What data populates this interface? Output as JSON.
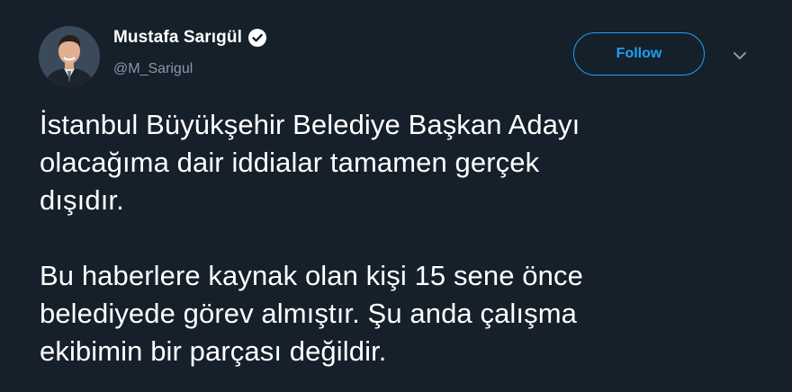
{
  "author": {
    "display_name": "Mustafa Sarıgül",
    "handle": "@M_Sarigul",
    "verified": true
  },
  "actions": {
    "follow_label": "Follow"
  },
  "tweet": {
    "paragraph1": [
      "İstanbul Büyükşehir Belediye Başkan Adayı",
      "olacağıma dair iddialar tamamen gerçek",
      "dışıdır."
    ],
    "paragraph2": [
      "Bu haberlere kaynak olan kişi 15 sene önce",
      "belediyede görev almıştır. Şu anda çalışma",
      "ekibimin bir parçası değildir."
    ]
  },
  "icons": {
    "verified": "verified-badge-icon",
    "more": "chevron-down-icon"
  },
  "colors": {
    "background": "#15202b",
    "accent": "#1da1f2",
    "secondary_text": "#8899a6",
    "text": "#ffffff"
  }
}
